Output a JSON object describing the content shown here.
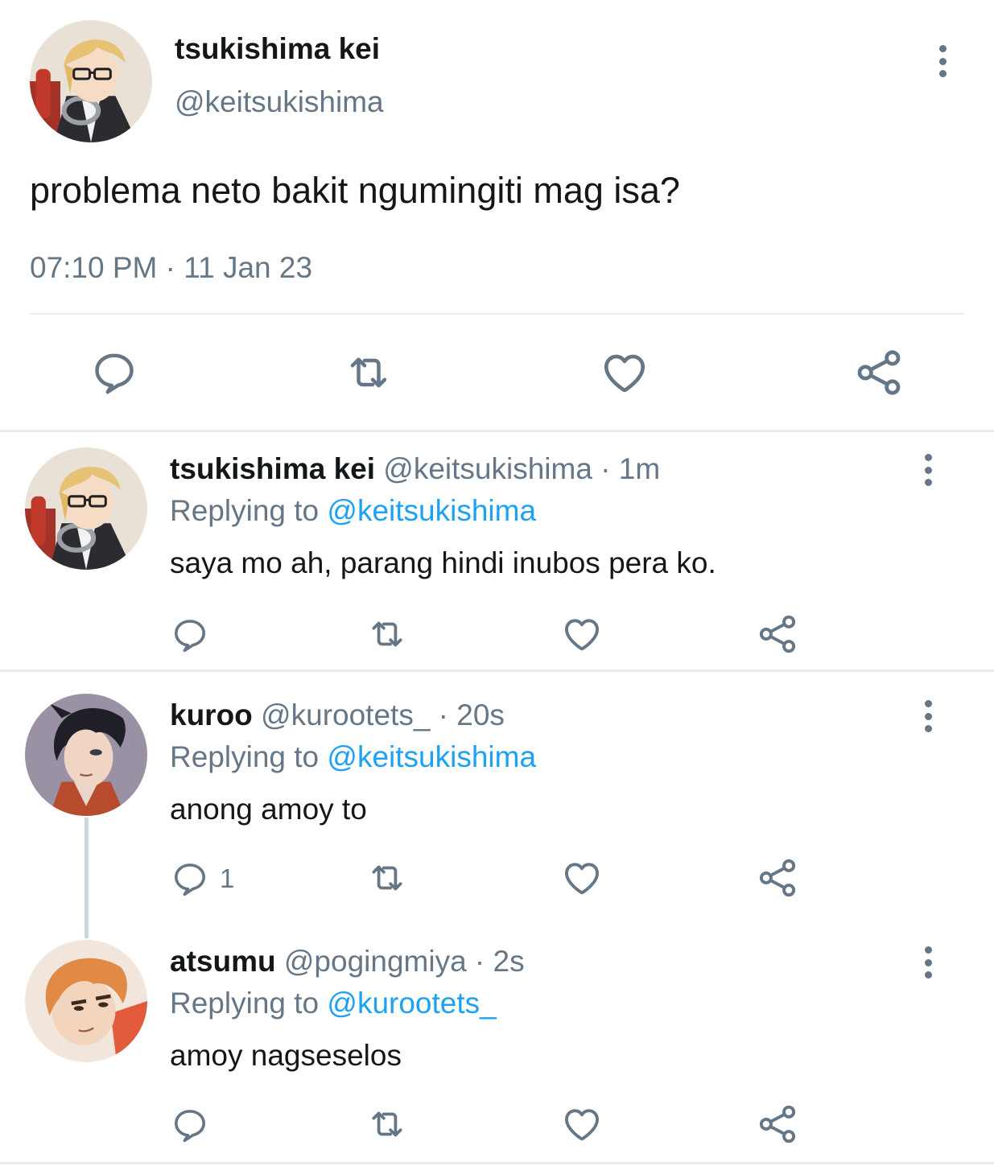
{
  "main_tweet": {
    "name": "tsukishima kei",
    "handle": "@keitsukishima",
    "text": "problema neto bakit ngumingiti mag isa?",
    "timestamp": "07:10 PM · 11 Jan 23",
    "avatar_icon": "avatar-tsukishima",
    "actions": [
      "reply-icon",
      "retweet-icon",
      "like-icon",
      "share-icon"
    ]
  },
  "replies": [
    {
      "name": "tsukishima kei",
      "meta": " @keitsukishima · 1m",
      "replying_prefix": "Replying to ",
      "replying_to": "@keitsukishima",
      "text": "saya mo ah, parang hindi inubos pera ko.",
      "reply_count": "",
      "avatar_icon": "avatar-tsukishima"
    },
    {
      "name": "kuroo",
      "meta": " @kurootets_ · 20s",
      "replying_prefix": "Replying to ",
      "replying_to": "@keitsukishima",
      "text": "anong amoy to",
      "reply_count": "1",
      "avatar_icon": "avatar-kuroo"
    },
    {
      "name": "atsumu",
      "meta": " @pogingmiya · 2s",
      "replying_prefix": "Replying to ",
      "replying_to": "@kurootets_",
      "text": "amoy nagseselos",
      "reply_count": "",
      "avatar_icon": "avatar-atsumu"
    }
  ],
  "colors": {
    "text": "#14171a",
    "muted": "#657786",
    "link": "#1da1f2",
    "divider": "#e6ecf0"
  }
}
